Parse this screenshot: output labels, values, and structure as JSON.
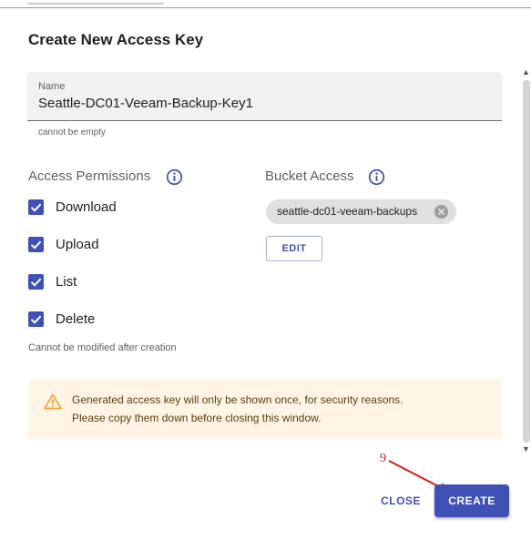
{
  "dialog": {
    "title": "Create New Access Key"
  },
  "name_field": {
    "label": "Name",
    "value": "Seattle-DC01-Veeam-Backup-Key1",
    "helper": "cannot be empty"
  },
  "access_permissions": {
    "title": "Access Permissions",
    "info_icon": "info-circle-icon",
    "options": [
      {
        "label": "Download",
        "checked": true
      },
      {
        "label": "Upload",
        "checked": true
      },
      {
        "label": "List",
        "checked": true
      },
      {
        "label": "Delete",
        "checked": true
      }
    ],
    "note": "Cannot be modified after creation"
  },
  "bucket_access": {
    "title": "Bucket Access",
    "info_icon": "info-circle-icon",
    "chip_label": "seattle-dc01-veeam-backups",
    "edit_label": "EDIT"
  },
  "warning": {
    "icon": "warning-triangle-icon",
    "line1": "Generated access key will only be shown once, for security reasons.",
    "line2": "Please copy them down before closing this window."
  },
  "annotation": {
    "number": "9"
  },
  "actions": {
    "close_label": "CLOSE",
    "create_label": "CREATE"
  },
  "colors": {
    "primary": "#3f51b5",
    "warning_bg": "#fff4e5",
    "warning_icon": "#f0a22e",
    "annotation": "#e01a1a"
  }
}
